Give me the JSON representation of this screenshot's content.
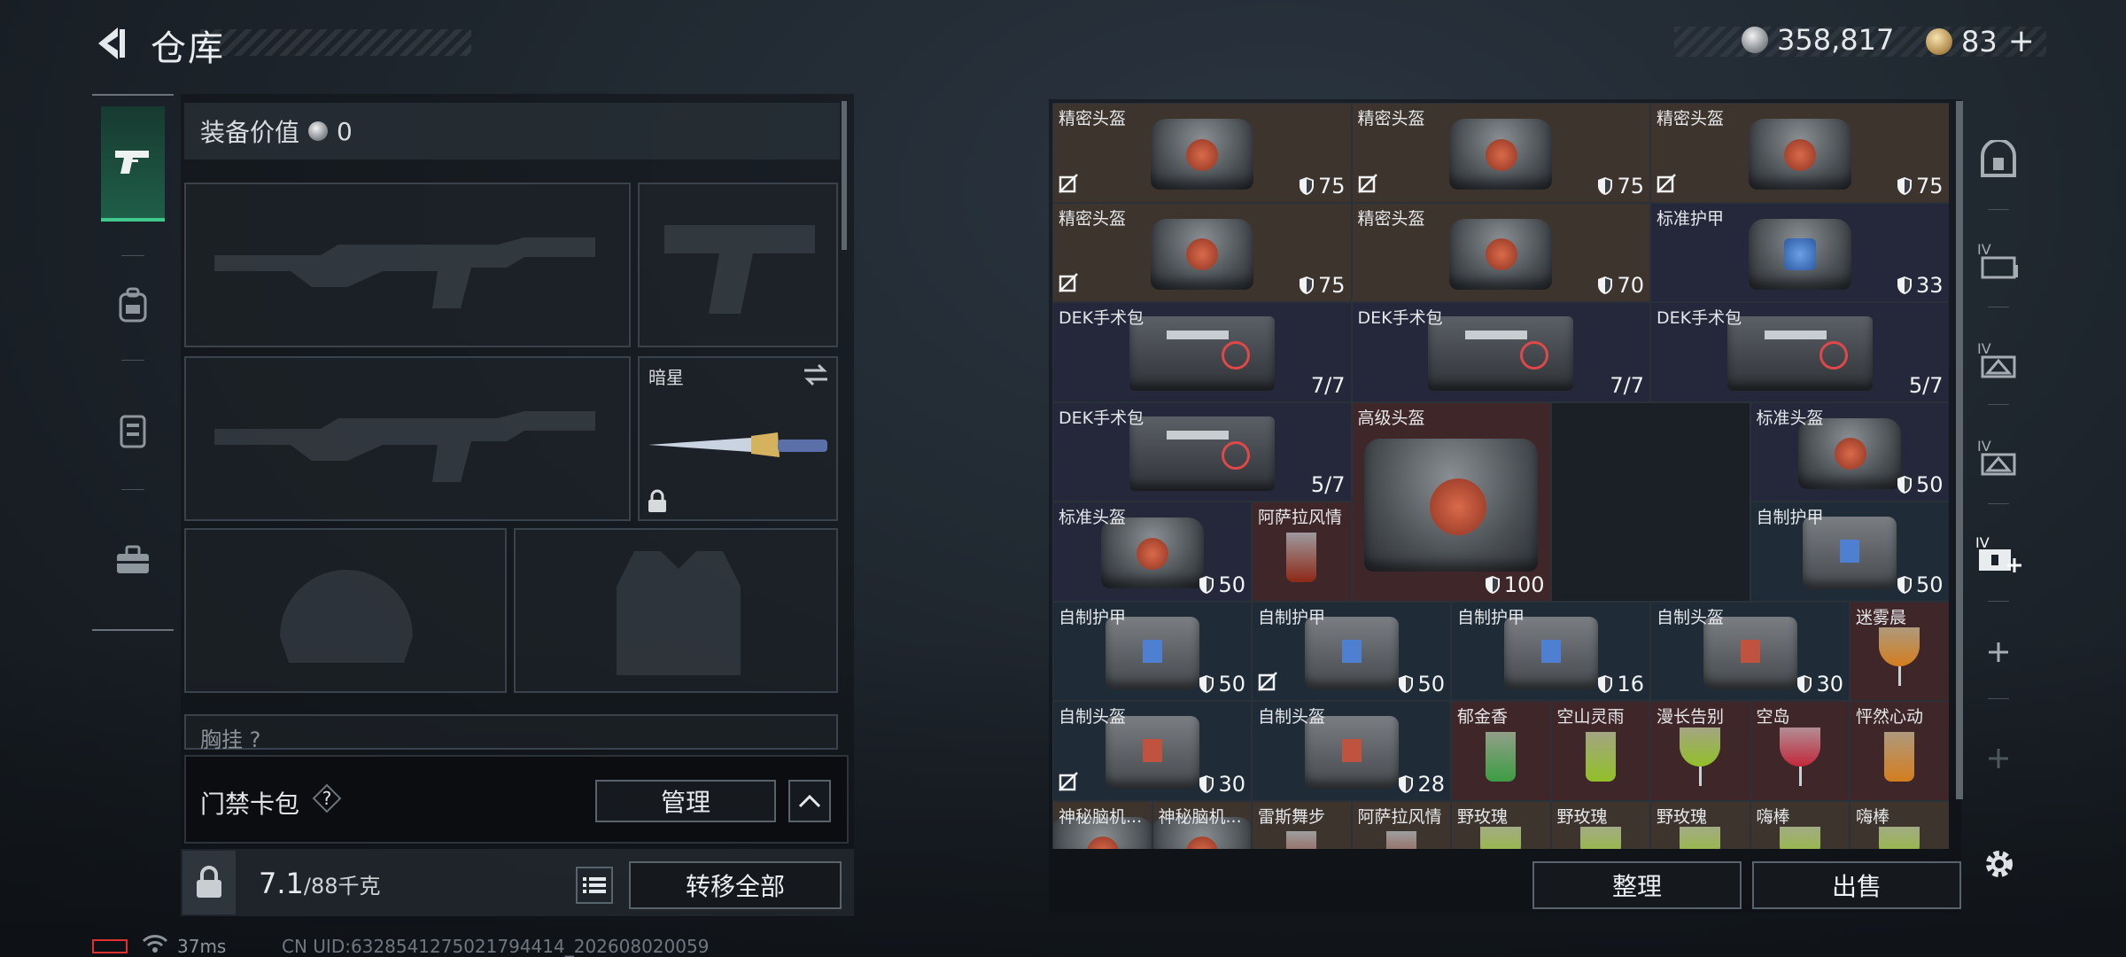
{
  "header": {
    "title": "仓库",
    "currency_primary": "358,817",
    "currency_secondary": "83"
  },
  "equipment": {
    "value_label": "装备价值",
    "value": "0",
    "knife_name": "暗星",
    "chest_label": "胸挂",
    "chest_help": "?"
  },
  "access_card": {
    "label": "门禁卡包",
    "help": "?",
    "manage_label": "管理"
  },
  "capacity": {
    "current": "7.1",
    "max": "/88千克",
    "transfer_label": "转移全部"
  },
  "status": {
    "ping": "37ms",
    "uid": "CN UID:6328541275021794414_202608020059"
  },
  "stash": {
    "organize_label": "整理",
    "sell_label": "出售",
    "items": [
      {
        "name": "精密头盔",
        "value": "75"
      },
      {
        "name": "精密头盔",
        "value": "75"
      },
      {
        "name": "精密头盔",
        "value": "75"
      },
      {
        "name": "精密头盔",
        "value": "75"
      },
      {
        "name": "精密头盔",
        "value": "70"
      },
      {
        "name": "标准护甲",
        "value": "33"
      },
      {
        "name": "DEK手术包",
        "value": "7/7"
      },
      {
        "name": "DEK手术包",
        "value": "7/7"
      },
      {
        "name": "DEK手术包",
        "value": "5/7"
      },
      {
        "name": "DEK手术包",
        "value": "5/7"
      },
      {
        "name": "高级头盔",
        "value": "100"
      },
      {
        "name": "标准头盔",
        "value": "50"
      },
      {
        "name": "标准头盔",
        "value": "50"
      },
      {
        "name": "阿萨拉风情",
        "value": ""
      },
      {
        "name": "自制护甲",
        "value": "50"
      },
      {
        "name": "自制护甲",
        "value": "50"
      },
      {
        "name": "自制护甲",
        "value": "50"
      },
      {
        "name": "自制护甲",
        "value": "16"
      },
      {
        "name": "自制头盔",
        "value": "30"
      },
      {
        "name": "迷雾晨",
        "value": ""
      },
      {
        "name": "自制头盔",
        "value": "30"
      },
      {
        "name": "自制头盔",
        "value": "28"
      },
      {
        "name": "郁金香",
        "value": ""
      },
      {
        "name": "空山灵雨",
        "value": ""
      },
      {
        "name": "漫长告别",
        "value": ""
      },
      {
        "name": "空岛",
        "value": ""
      },
      {
        "name": "怦然心动",
        "value": ""
      },
      {
        "name": "神秘脑机...",
        "value": ""
      },
      {
        "name": "神秘脑机...",
        "value": ""
      },
      {
        "name": "雷斯舞步",
        "value": ""
      },
      {
        "name": "阿萨拉风情",
        "value": ""
      },
      {
        "name": "野玫瑰",
        "value": ""
      },
      {
        "name": "野玫瑰",
        "value": ""
      },
      {
        "name": "野玫瑰",
        "value": ""
      },
      {
        "name": "嗨棒",
        "value": ""
      },
      {
        "name": "嗨棒",
        "value": ""
      }
    ]
  },
  "right_rail": {
    "tier_label": "IV"
  },
  "colors": {
    "accent_green": "#3fc98c",
    "cell_brown": "#3d342d",
    "cell_navy": "#25283b",
    "cell_teal": "#1f2c38",
    "cell_red": "#3f2628",
    "battery_red": "#e03030"
  },
  "icons": [
    "back-arrow-icon",
    "silver-coin-icon",
    "gold-coin-icon",
    "plus-icon",
    "pistol-icon",
    "backpack-icon",
    "vest-icon",
    "toolbox-icon",
    "lock-icon",
    "list-icon",
    "chevron-up-icon",
    "help-icon",
    "shield-icon",
    "no-insure-icon",
    "swap-icon",
    "settings-gear-icon",
    "wifi-icon",
    "battery-icon"
  ]
}
